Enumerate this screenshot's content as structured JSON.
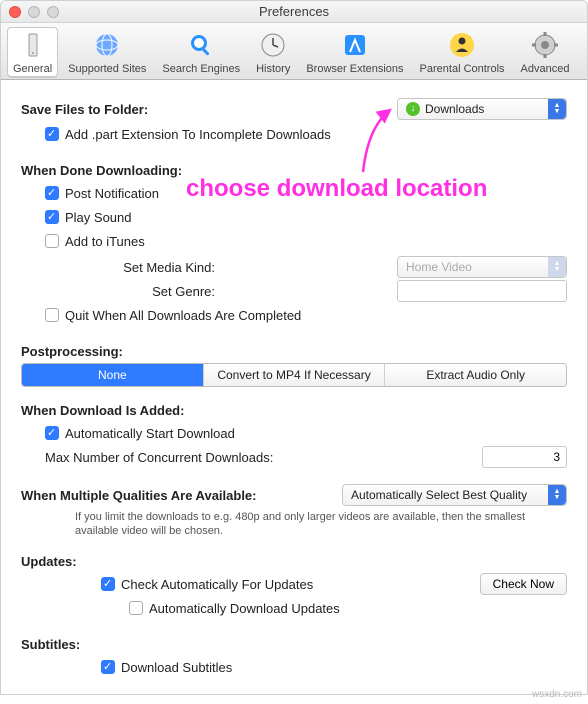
{
  "window": {
    "title": "Preferences"
  },
  "toolbar": {
    "items": [
      {
        "label": "General"
      },
      {
        "label": "Supported Sites"
      },
      {
        "label": "Search Engines"
      },
      {
        "label": "History"
      },
      {
        "label": "Browser Extensions"
      },
      {
        "label": "Parental Controls"
      },
      {
        "label": "Advanced"
      }
    ]
  },
  "save": {
    "section": "Save Files to Folder:",
    "folder": "Downloads",
    "add_part": "Add .part Extension To Incomplete Downloads"
  },
  "done": {
    "section": "When Done Downloading:",
    "post_notification": "Post Notification",
    "play_sound": "Play Sound",
    "add_itunes": "Add to iTunes",
    "media_kind_label": "Set Media Kind:",
    "media_kind": "Home Video",
    "genre_label": "Set Genre:",
    "genre": "",
    "quit": "Quit When All Downloads Are Completed"
  },
  "post": {
    "section": "Postprocessing:",
    "none": "None",
    "convert": "Convert to MP4 If Necessary",
    "audio": "Extract Audio Only"
  },
  "added": {
    "section": "When Download Is Added:",
    "auto_start": "Automatically Start Download",
    "max_label": "Max Number of Concurrent Downloads:",
    "max_value": "3"
  },
  "quality": {
    "section": "When Multiple Qualities Are Available:",
    "value": "Automatically Select Best Quality",
    "hint": "If you limit the downloads to e.g. 480p and only larger videos are available, then the smallest available video will be chosen."
  },
  "updates": {
    "section": "Updates:",
    "check": "Check Automatically For Updates",
    "auto_dl": "Automatically Download Updates",
    "btn": "Check Now"
  },
  "subtitles": {
    "section": "Subtitles:",
    "dl": "Download Subtitles"
  },
  "annotation": "choose download location",
  "watermark": "wsxdn.com"
}
